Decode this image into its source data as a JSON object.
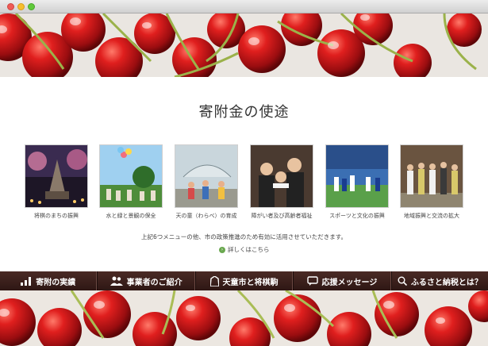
{
  "page": {
    "title": "寄附金の使途",
    "note": "上記6つメニューの他、市の政策推進のため有効に活用させていただきます。",
    "more_link": "詳しくはこちら"
  },
  "cards": [
    {
      "label": "将棋のまちの振興"
    },
    {
      "label": "水と緑と景観の保全"
    },
    {
      "label": "天の童（わらべ）の育成"
    },
    {
      "label": "障がい者及び高齢者福祉"
    },
    {
      "label": "スポーツと文化の振興"
    },
    {
      "label": "地域振興と交流の拡大"
    }
  ],
  "nav": [
    {
      "label": "寄附の実績",
      "icon": "bar-chart-icon"
    },
    {
      "label": "事業者のご紹介",
      "icon": "people-icon"
    },
    {
      "label": "天童市と将棋駒",
      "icon": "shogi-piece-icon"
    },
    {
      "label": "応援メッセージ",
      "icon": "message-icon"
    },
    {
      "label": "ふるさと納税とは？",
      "icon": "search-icon"
    }
  ],
  "colors": {
    "nav_bg": "#3a1f1b",
    "cherry_red": "#c0141a",
    "accent_green": "#6aa84f"
  }
}
